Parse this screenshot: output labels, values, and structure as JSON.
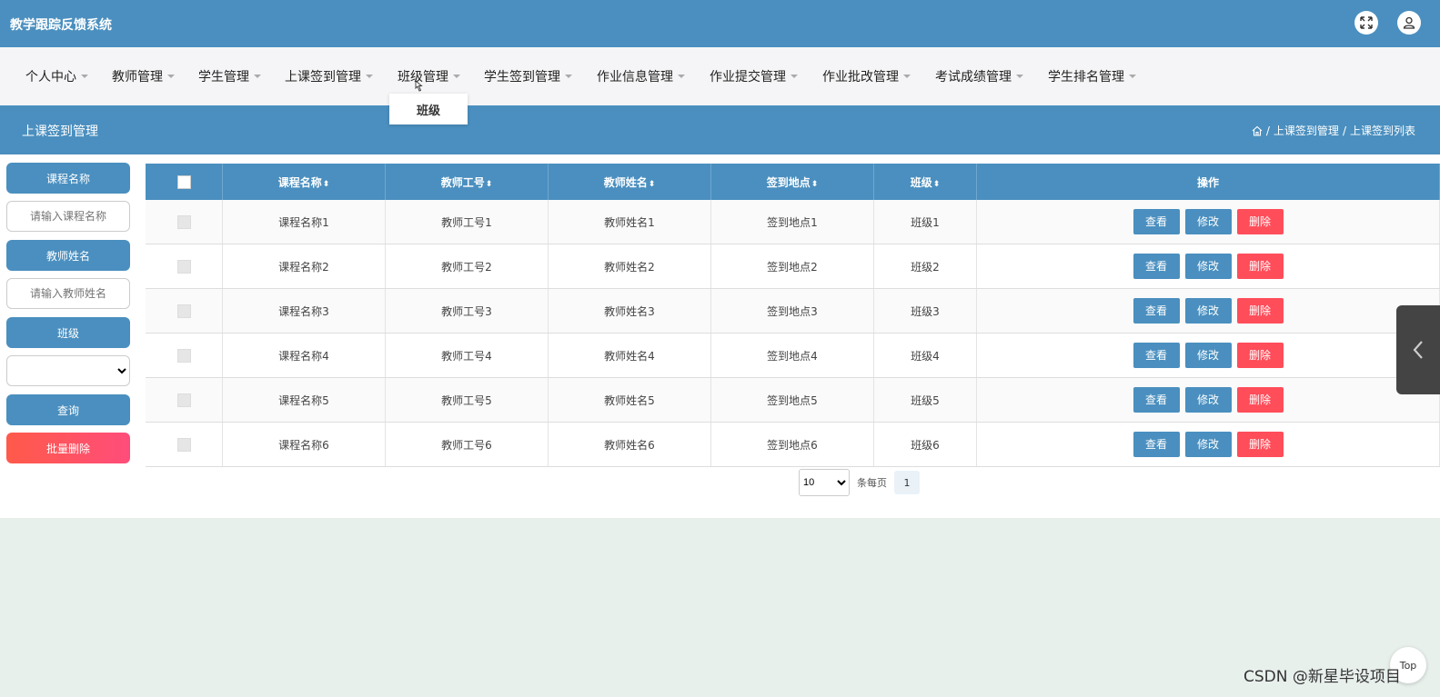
{
  "app": {
    "title": "教学跟踪反馈系统"
  },
  "nav": {
    "items": [
      {
        "label": "个人中心"
      },
      {
        "label": "教师管理"
      },
      {
        "label": "学生管理"
      },
      {
        "label": "上课签到管理"
      },
      {
        "label": "班级管理"
      },
      {
        "label": "学生签到管理"
      },
      {
        "label": "作业信息管理"
      },
      {
        "label": "作业提交管理"
      },
      {
        "label": "作业批改管理"
      },
      {
        "label": "考试成绩管理"
      },
      {
        "label": "学生排名管理"
      }
    ],
    "dropdown_item": "班级"
  },
  "section": {
    "title": "上课签到管理",
    "breadcrumb": [
      "上课签到管理",
      "上课签到列表"
    ],
    "separator": "/"
  },
  "search": {
    "course_label": "课程名称",
    "course_placeholder": "请输入课程名称",
    "teacher_label": "教师姓名",
    "teacher_placeholder": "请输入教师姓名",
    "class_label": "班级",
    "query_button": "查询",
    "batch_delete_button": "批量删除"
  },
  "table": {
    "headers": [
      "课程名称",
      "教师工号",
      "教师姓名",
      "签到地点",
      "班级",
      "操作"
    ],
    "sort_glyph": "⬍",
    "rows": [
      [
        "课程名称1",
        "教师工号1",
        "教师姓名1",
        "签到地点1",
        "班级1"
      ],
      [
        "课程名称2",
        "教师工号2",
        "教师姓名2",
        "签到地点2",
        "班级2"
      ],
      [
        "课程名称3",
        "教师工号3",
        "教师姓名3",
        "签到地点3",
        "班级3"
      ],
      [
        "课程名称4",
        "教师工号4",
        "教师姓名4",
        "签到地点4",
        "班级4"
      ],
      [
        "课程名称5",
        "教师工号5",
        "教师姓名5",
        "签到地点5",
        "班级5"
      ],
      [
        "课程名称6",
        "教师工号6",
        "教师姓名6",
        "签到地点6",
        "班级6"
      ]
    ],
    "actions": {
      "view": "查看",
      "edit": "修改",
      "delete": "删除"
    }
  },
  "pagination": {
    "page_size": "10",
    "per_page_label": "条每页",
    "current_page": "1"
  },
  "misc": {
    "top_button": "Top",
    "watermark": "CSDN @新星毕设项目"
  },
  "colors": {
    "primary": "#4a8fbf",
    "danger": "#ff4d5a",
    "background": "#e8f0ec"
  }
}
